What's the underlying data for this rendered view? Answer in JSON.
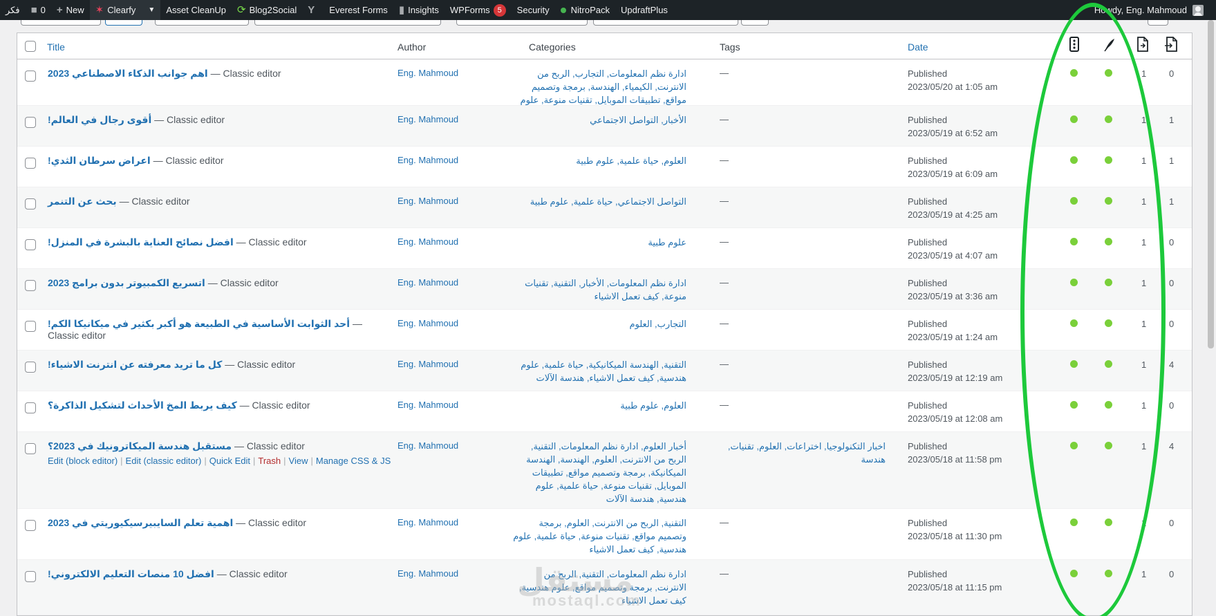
{
  "admin_bar": {
    "site_name": "فكر",
    "comments_count": "0",
    "new_label": "New",
    "clearfy_label": "Clearfy",
    "asset_cleanup_label": "Asset CleanUp",
    "blog2social_label": "Blog2Social",
    "everest_forms_label": "Everest Forms",
    "insights_label": "Insights",
    "wpforms_label": "WPForms",
    "wpforms_badge": "5",
    "security_label": "Security",
    "nitropack_label": "NitroPack",
    "updraftplus_label": "UpdraftPlus",
    "howdy": "Howdy, Eng. Mahmoud"
  },
  "table": {
    "headers": {
      "title": "Title",
      "author": "Author",
      "categories": "Categories",
      "tags": "Tags",
      "date": "Date"
    },
    "header_icons": [
      "seo-score-icon",
      "readability-icon",
      "outgoing-links-icon",
      "incoming-links-icon"
    ],
    "rows": [
      {
        "title": "اهم جوانب الذكاء الاصطناعي 2023",
        "sep": " — ",
        "state": "Classic editor",
        "author": "Eng. Mahmoud",
        "categories": "ادارة نظم المعلومات, التجارب, الربح من الانترنت, الكيمياء, الهندسة, برمجة وتصميم مواقع, تطبيقات الموبايل, تقنيات منوعة, علوم هندسية",
        "tags": "—",
        "status": "Published",
        "date": "2023/05/20 at 1:05 am",
        "seo": "good",
        "readability": "good",
        "links_out": "1",
        "links_in": "0"
      },
      {
        "title": "أقوى رجال في العالم!",
        "sep": " — ",
        "state": "Classic editor",
        "author": "Eng. Mahmoud",
        "categories": "الأخبار, التواصل الاجتماعي",
        "tags": "—",
        "status": "Published",
        "date": "2023/05/19 at 6:52 am",
        "seo": "good",
        "readability": "good",
        "links_out": "1",
        "links_in": "1"
      },
      {
        "title": "اعراض سرطان الثدي!",
        "sep": " — ",
        "state": "Classic editor",
        "author": "Eng. Mahmoud",
        "categories": "العلوم, حياة علمية, علوم طبية",
        "tags": "—",
        "status": "Published",
        "date": "2023/05/19 at 6:09 am",
        "seo": "good",
        "readability": "good",
        "links_out": "1",
        "links_in": "1"
      },
      {
        "title": "بحث عن التنمر",
        "sep": " — ",
        "state": "Classic editor",
        "author": "Eng. Mahmoud",
        "categories": "التواصل الاجتماعي, حياة علمية, علوم طبية",
        "tags": "—",
        "status": "Published",
        "date": "2023/05/19 at 4:25 am",
        "seo": "good",
        "readability": "good",
        "links_out": "1",
        "links_in": "1"
      },
      {
        "title": "افضل نصائح العناية بالبشرة في المنزل!",
        "sep": " — ",
        "state": "Classic editor",
        "author": "Eng. Mahmoud",
        "categories": "علوم طبية",
        "tags": "—",
        "status": "Published",
        "date": "2023/05/19 at 4:07 am",
        "seo": "good",
        "readability": "good",
        "links_out": "1",
        "links_in": "0"
      },
      {
        "title": "اتسريع الكمبيوتر بدون برامج 2023",
        "sep": " — ",
        "state": "Classic editor",
        "author": "Eng. Mahmoud",
        "categories": "ادارة نظم المعلومات, الأخبار, التقنية, تقنيات منوعة, كيف تعمل الاشياء",
        "tags": "—",
        "status": "Published",
        "date": "2023/05/19 at 3:36 am",
        "seo": "good",
        "readability": "good",
        "links_out": "1",
        "links_in": "0"
      },
      {
        "title": "أحد الثوابت الأساسية في الطبيعة هو أكبر بكثير في ميكانيكا الكم!",
        "sep": " — ",
        "state": "Classic editor",
        "author": "Eng. Mahmoud",
        "categories": "التجارب, العلوم",
        "tags": "—",
        "status": "Published",
        "date": "2023/05/19 at 1:24 am",
        "seo": "good",
        "readability": "good",
        "links_out": "1",
        "links_in": "0"
      },
      {
        "title": "كل ما تريد معرفته عن انترنت الاشياء!",
        "sep": " — ",
        "state": "Classic editor",
        "author": "Eng. Mahmoud",
        "categories": "التقنية, الهندسة الميكانيكية, حياة علمية, علوم هندسية, كيف تعمل الاشياء, هندسة الآلات",
        "tags": "—",
        "status": "Published",
        "date": "2023/05/19 at 12:19 am",
        "seo": "good",
        "readability": "good",
        "links_out": "1",
        "links_in": "4"
      },
      {
        "title": "كيف يربط المخ الأحداث لتشكيل الذاكرة؟",
        "sep": " — ",
        "state": "Classic editor",
        "author": "Eng. Mahmoud",
        "categories": "العلوم, علوم طبية",
        "tags": "—",
        "status": "Published",
        "date": "2023/05/19 at 12:08 am",
        "seo": "good",
        "readability": "good",
        "links_out": "1",
        "links_in": "0"
      },
      {
        "title": "مستقبل هندسة الميكاترونيك في 2023؟",
        "sep": " — ",
        "state": "Classic editor",
        "author": "Eng. Mahmoud",
        "categories": "أخبار العلوم, ادارة نظم المعلومات, التقنية, الربح من الانترنت, العلوم, الهندسة, الهندسة الميكانيكة, برمجة وتصميم مواقع, تطبيقات الموبايل, تقنيات منوعة, حياة علمية, علوم هندسية, هندسة الآلات",
        "tags": "اخبار التكنولوجيا, اختراعات, العلوم, تقنيات, هندسة",
        "status": "Published",
        "date": "2023/05/18 at 11:58 pm",
        "seo": "good",
        "readability": "good",
        "links_out": "1",
        "links_in": "4",
        "row_actions": [
          "Edit (block editor)",
          "Edit (classic editor)",
          "Quick Edit",
          "Trash",
          "View",
          "Manage CSS & JS"
        ]
      },
      {
        "title": "اهمية تعلم السايبيرسيكيوريتي في 2023",
        "sep": " — ",
        "state": "Classic editor",
        "author": "Eng. Mahmoud",
        "categories": "التقنية, الربح من الانترنت, العلوم, برمجة وتصميم مواقع, تقنيات منوعة, حياة علمية, علوم هندسية, كيف تعمل الاشياء",
        "tags": "—",
        "status": "Published",
        "date": "2023/05/18 at 11:30 pm",
        "seo": "good",
        "readability": "good",
        "links_out": "1",
        "links_in": "0"
      },
      {
        "title": "افضل 10 منصات التعليم الالكتروني!",
        "sep": " — ",
        "state": "Classic editor",
        "author": "Eng. Mahmoud",
        "categories": "ادارة نظم المعلومات, التقنية, الربح من الانترنت, برمجة وتصميم مواقع, علوم هندسية, كيف تعمل الاشياء",
        "tags": "—",
        "status": "Published",
        "date": "2023/05/18 at 11:15 pm",
        "seo": "good",
        "readability": "good",
        "links_out": "1",
        "links_in": "0"
      }
    ]
  },
  "overlay": {
    "highlight_color": "#1dc93b",
    "watermark": "مستقل",
    "watermark_sub": "mostaql.com"
  },
  "colors": {
    "link": "#2271b1",
    "seo_good": "#7ad03a",
    "adminbar_bg": "#1d2327",
    "trash": "#b32d2e"
  }
}
